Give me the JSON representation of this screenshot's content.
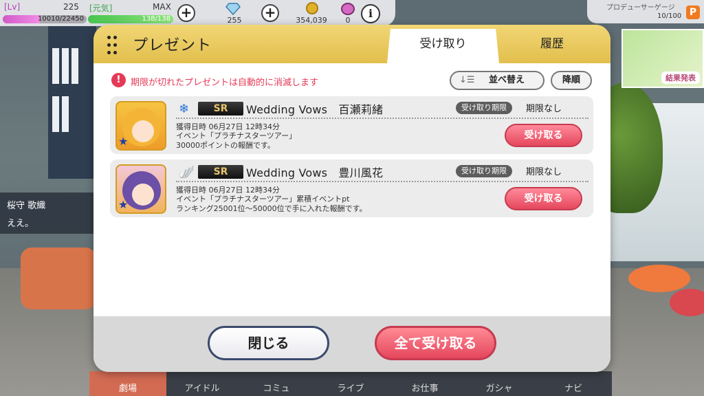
{
  "status": {
    "lv_label": "[Lv]",
    "lv_value": "225",
    "exp_text": "10010/22450",
    "exp_progress": 0.446,
    "genki_label": "[元気]",
    "genki_max": "MAX",
    "genki_text": "138/138",
    "genki_progress": 1.0,
    "gem_count": "255",
    "coin_count": "354,039",
    "ticket_count": "0",
    "plus_glyph": "+",
    "info_glyph": "i"
  },
  "produce": {
    "label": "プロデューサーゲージ",
    "value": "10/100",
    "badge": "P"
  },
  "result_card": {
    "label": "結果発表"
  },
  "background": {
    "speaker_name": "桜守 歌織",
    "speaker_line": "ええ。"
  },
  "dialog": {
    "title": "プレゼント",
    "tabs": [
      {
        "label": "受け取り",
        "active": true
      },
      {
        "label": "履歴",
        "active": false
      }
    ],
    "warning": "期限が切れたプレゼントは自動的に消滅します",
    "warning_icon": "!",
    "sort_icon": "↓☰",
    "sort_label": "並べ替え",
    "order_label": "降順",
    "items": [
      {
        "attribute_icon": "❄",
        "rarity": "SR",
        "title": "Wedding Vows　百瀬莉緒",
        "limit_label": "受け取り期限",
        "limit_value": "期限なし",
        "date": "獲得日時 06月27日 12時34分",
        "desc_lines": [
          "イベント「プラチナスターツアー」",
          "30000ポイントの報酬です。"
        ],
        "button": "受け取る",
        "thumb_color": "#f6c441"
      },
      {
        "attribute_icon": "🪽",
        "rarity": "SR",
        "title": "Wedding Vows　豊川風花",
        "limit_label": "受け取り期限",
        "limit_value": "期限なし",
        "date": "獲得日時 06月27日 12時34分",
        "desc_lines": [
          "イベント「プラチナスターツアー」累積イベントpt",
          "ランキング25001位～50000位で手に入れた報酬です。"
        ],
        "button": "受け取る",
        "thumb_color": "#f3c8d8"
      }
    ],
    "close_label": "閉じる",
    "receive_all_label": "全て受け取る"
  },
  "bottom_nav": [
    "劇場",
    "アイドル",
    "コミュ",
    "ライブ",
    "お仕事",
    "ガシャ",
    "ナビ"
  ],
  "colors": {
    "accent_pink": "#e5475d",
    "header_gold": "#e2bf4d",
    "warning_red": "#e53a57"
  }
}
